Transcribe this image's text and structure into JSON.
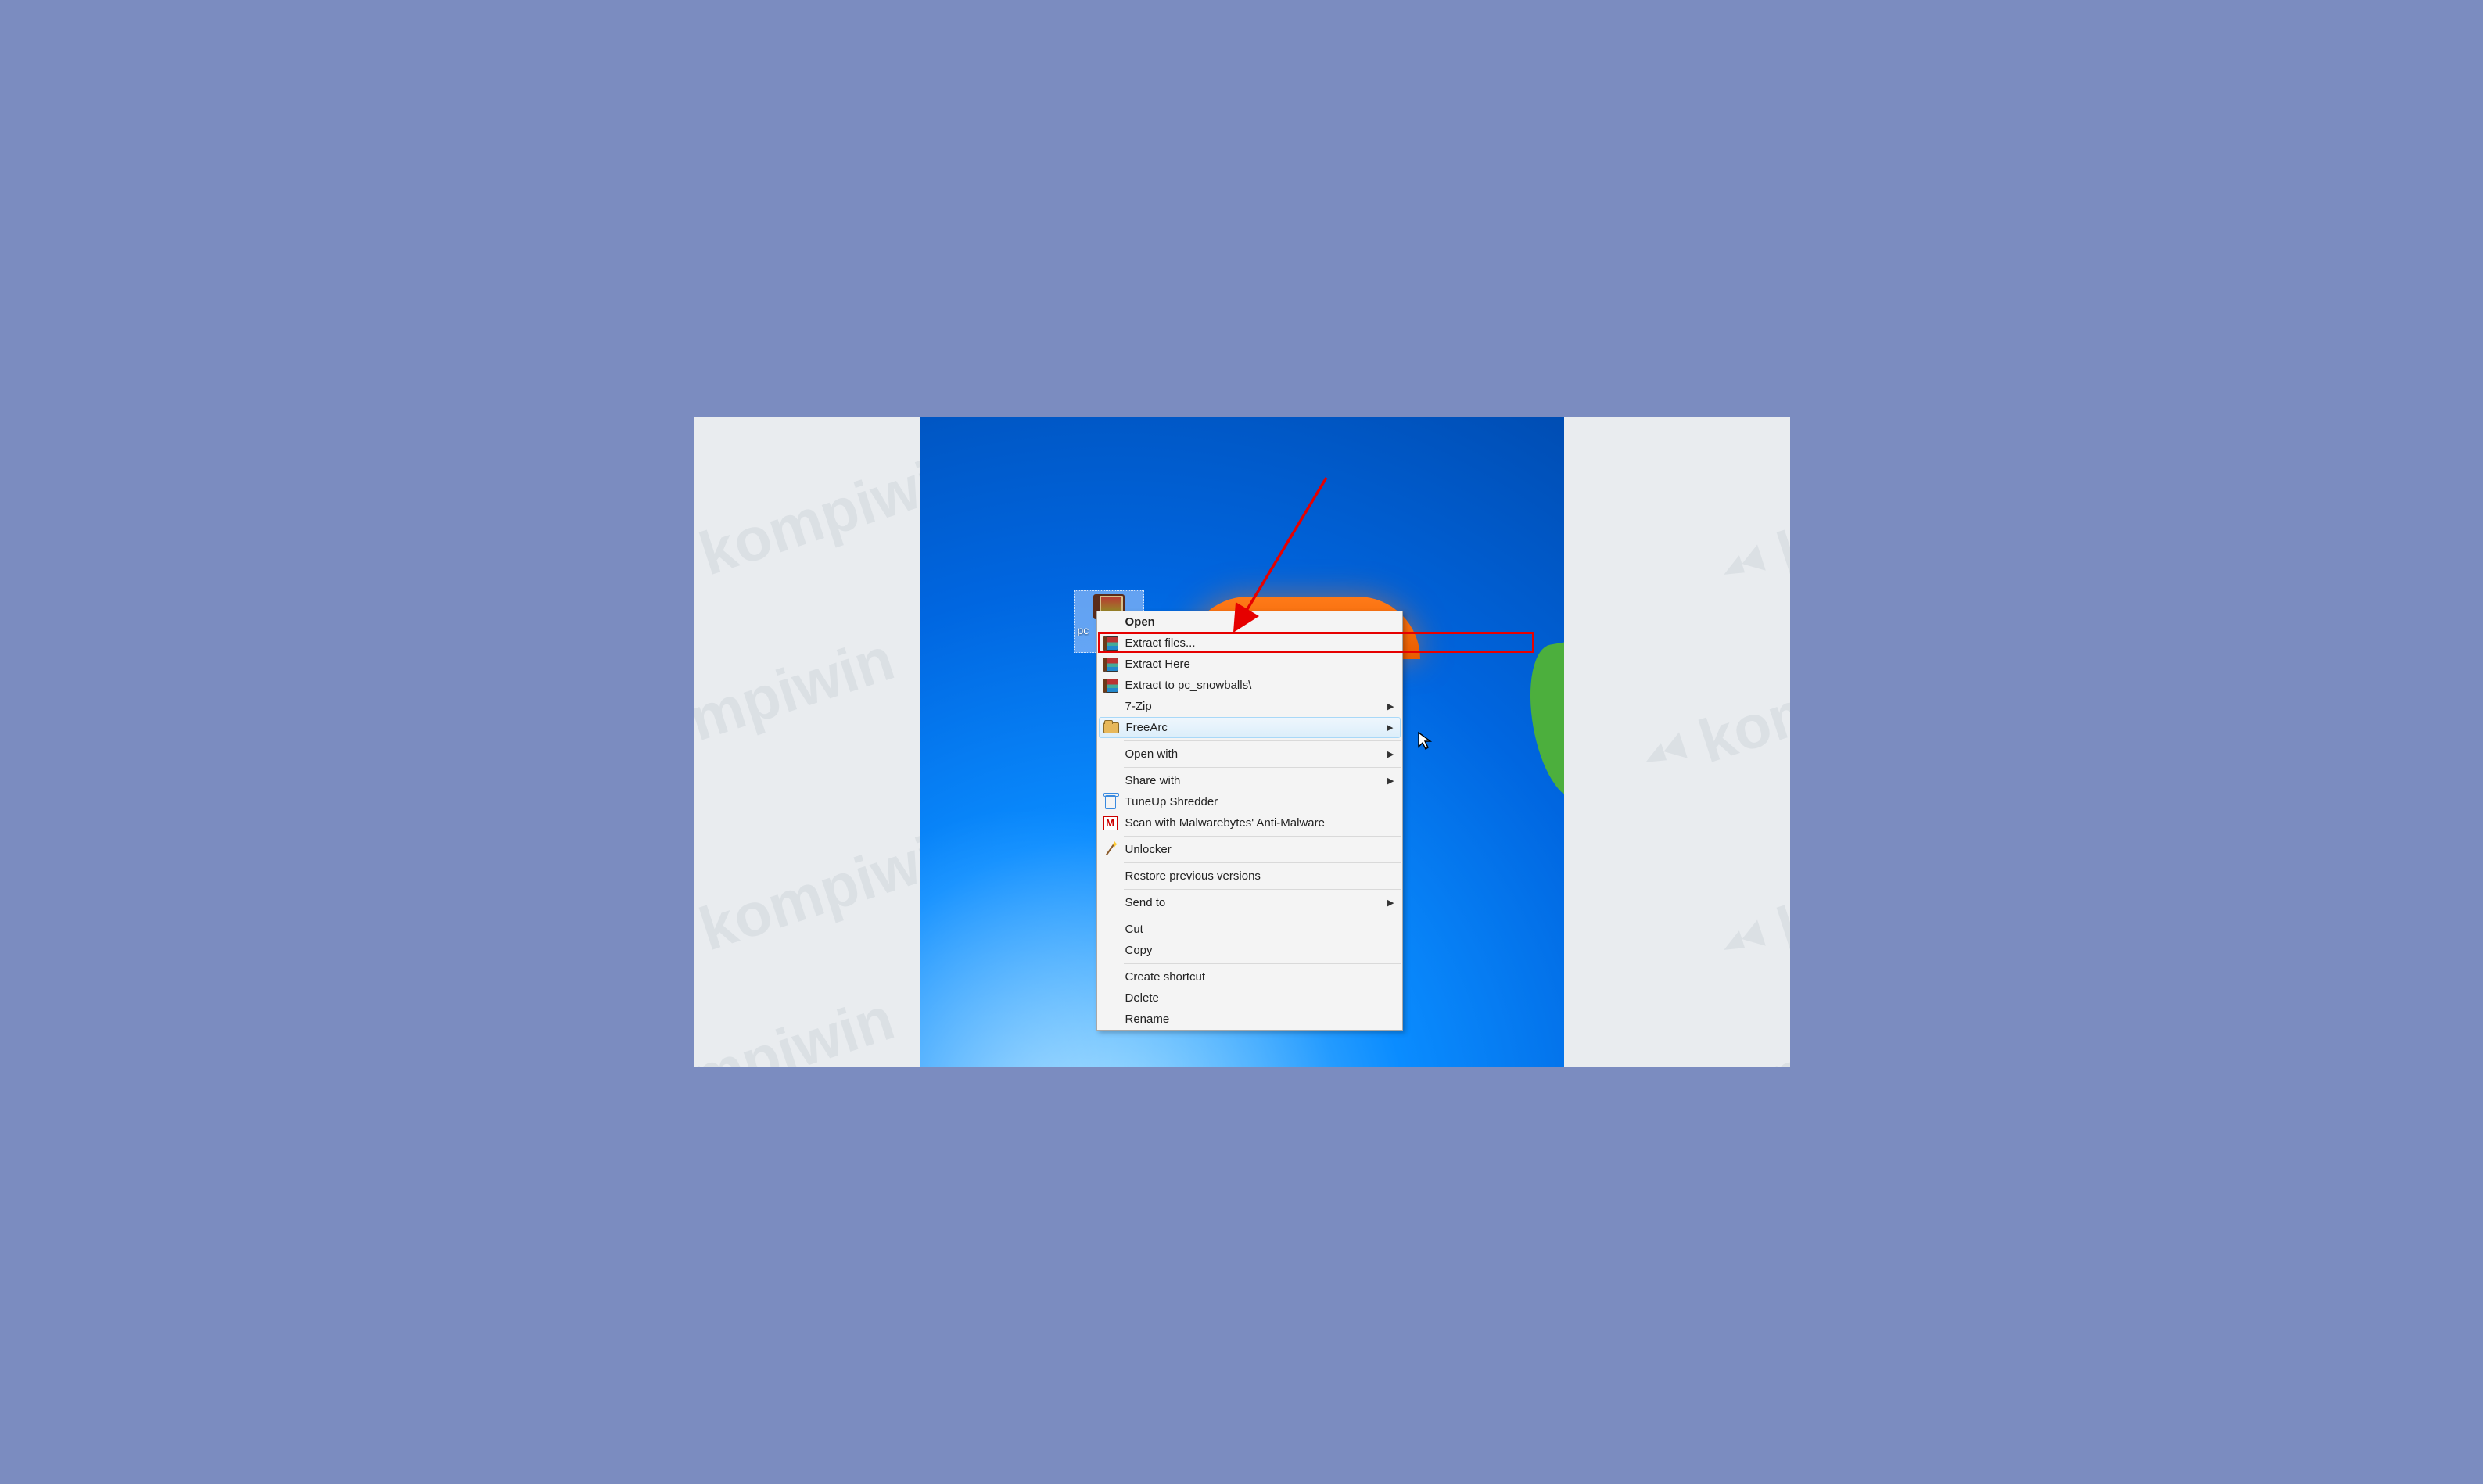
{
  "watermark_text": "kompiwin",
  "file": {
    "label_visible": "pc"
  },
  "menu": {
    "items": [
      {
        "label": "Open",
        "icon": "none",
        "bold": true
      },
      {
        "label": "Extract files...",
        "icon": "rar",
        "highlighted": true
      },
      {
        "label": "Extract Here",
        "icon": "rar"
      },
      {
        "label": "Extract to pc_snowballs\\",
        "icon": "rar"
      },
      {
        "label": "7-Zip",
        "icon": "none",
        "submenu": true
      },
      {
        "label": "FreeArc",
        "icon": "folder",
        "submenu": true,
        "hovered": true
      },
      {
        "sep": true
      },
      {
        "label": "Open with",
        "icon": "none",
        "submenu": true
      },
      {
        "sep": true
      },
      {
        "label": "Share with",
        "icon": "none",
        "submenu": true
      },
      {
        "label": "TuneUp Shredder",
        "icon": "trash"
      },
      {
        "label": "Scan with Malwarebytes' Anti-Malware",
        "icon": "m"
      },
      {
        "sep": true
      },
      {
        "label": "Unlocker",
        "icon": "wand"
      },
      {
        "sep": true
      },
      {
        "label": "Restore previous versions",
        "icon": "none"
      },
      {
        "sep": true
      },
      {
        "label": "Send to",
        "icon": "none",
        "submenu": true
      },
      {
        "sep": true
      },
      {
        "label": "Cut",
        "icon": "none"
      },
      {
        "label": "Copy",
        "icon": "none"
      },
      {
        "sep": true
      },
      {
        "label": "Create shortcut",
        "icon": "none"
      },
      {
        "label": "Delete",
        "icon": "none"
      },
      {
        "label": "Rename",
        "icon": "none"
      }
    ]
  }
}
